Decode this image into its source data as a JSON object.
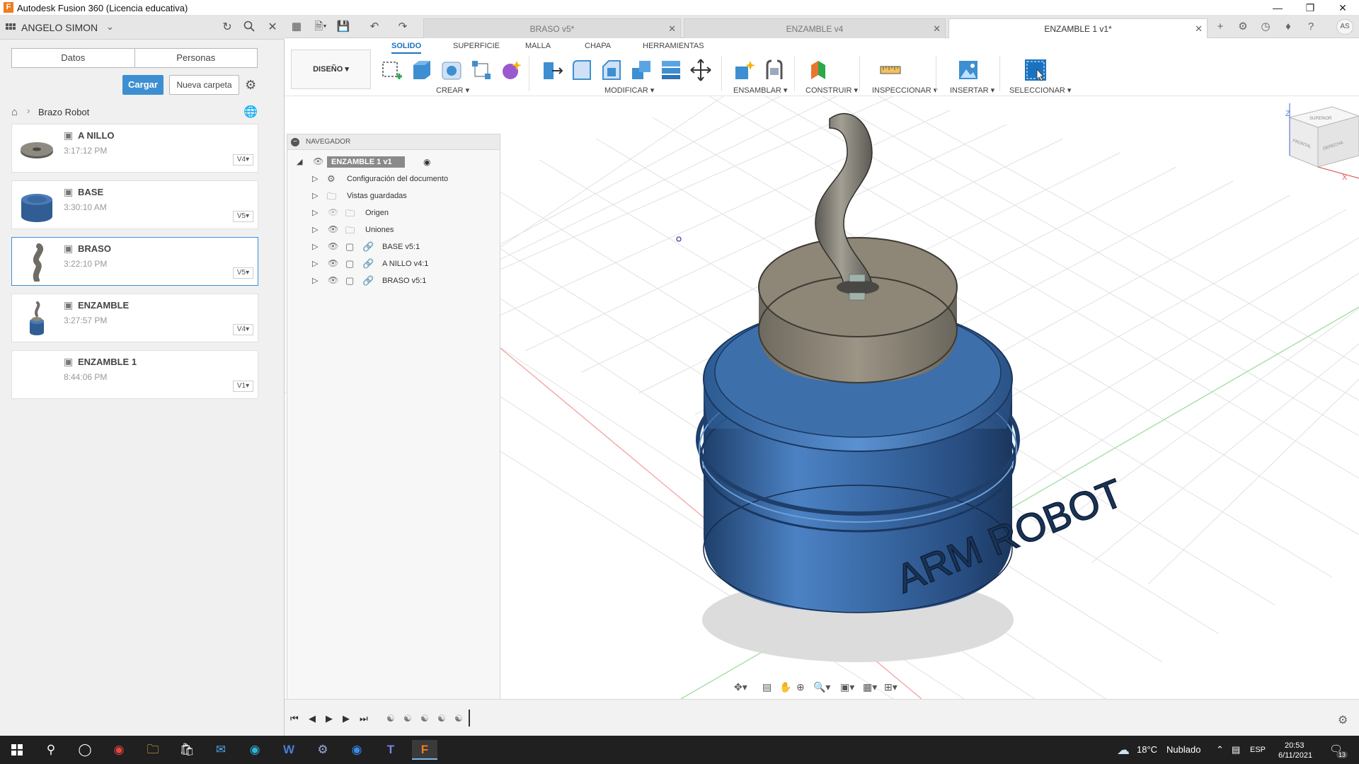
{
  "window": {
    "title": "Autodesk Fusion 360 (Licencia educativa)",
    "app_icon": "F"
  },
  "data_panel": {
    "user": "ANGELO SIMON",
    "tabs": [
      "Datos",
      "Personas"
    ],
    "upload_label": "Cargar",
    "new_folder_label": "Nueva carpeta",
    "breadcrumb": "Brazo Robot",
    "files": [
      {
        "name": "A NILLO",
        "time": "3:17:12 PM",
        "version": "V4"
      },
      {
        "name": "BASE",
        "time": "3:30:10 AM",
        "version": "V5"
      },
      {
        "name": "BRASO",
        "time": "3:22:10 PM",
        "version": "V5"
      },
      {
        "name": "ENZAMBLE",
        "time": "3:27:57 PM",
        "version": "V4"
      },
      {
        "name": "ENZAMBLE 1",
        "time": "8:44:06 PM",
        "version": "V1"
      }
    ]
  },
  "doc_tabs": [
    {
      "label": "BRASO v5*",
      "active": false
    },
    {
      "label": "ENZAMBLE v4",
      "active": false
    },
    {
      "label": "ENZAMBLE 1 v1*",
      "active": true
    }
  ],
  "user_initials": "AS",
  "toolbar": {
    "workspace": "DISEÑO",
    "tabs": [
      "SOLIDO",
      "SUPERFICIE",
      "MALLA",
      "CHAPA",
      "HERRAMIENTAS"
    ],
    "groups": [
      "CREAR",
      "MODIFICAR",
      "ENSAMBLAR",
      "CONSTRUIR",
      "INSPECCIONAR",
      "INSERTAR",
      "SELECCIONAR"
    ]
  },
  "navigator": {
    "title": "NAVEGADOR",
    "root": "ENZAMBLE 1 v1",
    "items": [
      "Configuración del documento",
      "Vistas guardadas",
      "Origen",
      "Uniones",
      "BASE v5:1",
      "A NILLO v4:1",
      "BRASO v5:1"
    ]
  },
  "viewcube": {
    "top": "SUPERIOR",
    "front": "FRONTAL",
    "right": "DERECHA",
    "z": "Z",
    "x": "X"
  },
  "model_text": "ARM ROBOT",
  "taskbar": {
    "temperature": "18°C",
    "weather": "Nublado",
    "lang": "ESP",
    "time": "20:53",
    "date": "6/11/2021",
    "notifications": "13"
  },
  "colors": {
    "accent": "#3d8fd1",
    "model_blue": "#3b6aa3",
    "model_bronze": "#8e8676",
    "taskbar": "#202020"
  }
}
